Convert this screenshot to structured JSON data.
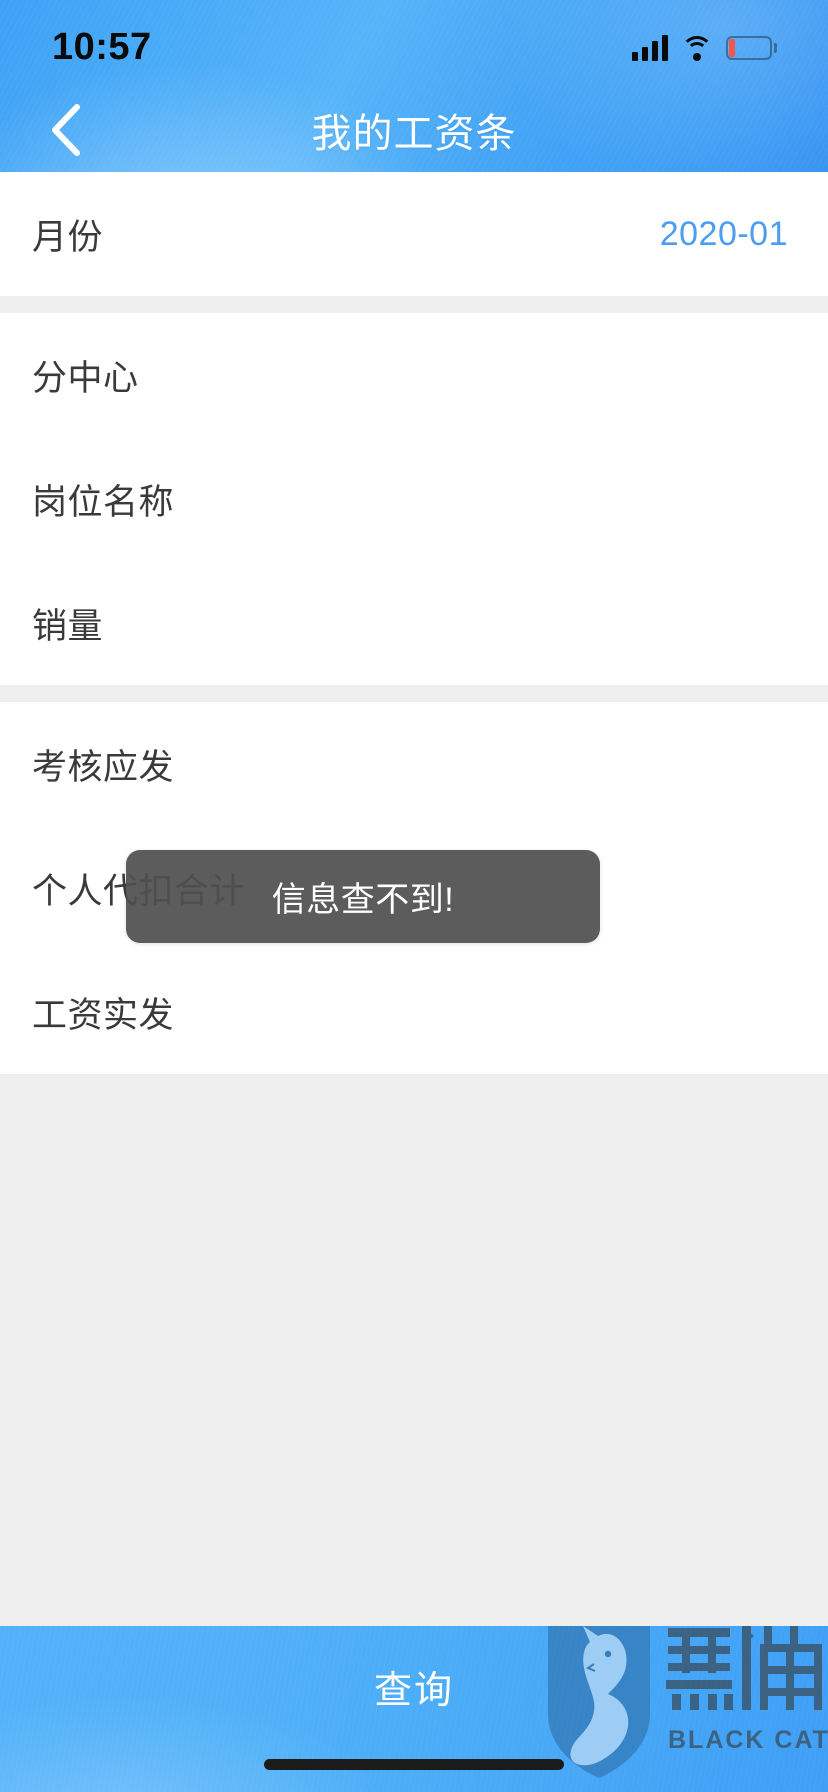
{
  "status_bar": {
    "time": "10:57",
    "signal_icon": "cellular-signal-icon",
    "wifi_icon": "wifi-icon",
    "battery_icon": "battery-low-icon",
    "battery_level_percent": 12
  },
  "header": {
    "title": "我的工资条",
    "back_icon": "back-chevron-icon",
    "bg_color": "#46a6f6"
  },
  "form": {
    "sections": [
      {
        "rows": [
          {
            "label": "月份",
            "value": "2020-01",
            "value_color": "#4a9df0"
          }
        ]
      },
      {
        "rows": [
          {
            "label": "分中心",
            "value": ""
          },
          {
            "label": "岗位名称",
            "value": ""
          },
          {
            "label": "销量",
            "value": ""
          }
        ]
      },
      {
        "rows": [
          {
            "label": "考核应发",
            "value": ""
          },
          {
            "label": "个人代扣合计",
            "value": ""
          },
          {
            "label": "工资实发",
            "value": ""
          }
        ]
      }
    ]
  },
  "toast": {
    "message": "信息查不到!",
    "bg_color": "#505050",
    "text_color": "#ffffff"
  },
  "bottom_bar": {
    "query_label": "查询",
    "bg_color": "#4aabf8"
  },
  "watermark": {
    "brand_cn": "黑猫",
    "brand_en": "BLACK CAT",
    "shield_icon": "black-cat-shield-icon"
  }
}
